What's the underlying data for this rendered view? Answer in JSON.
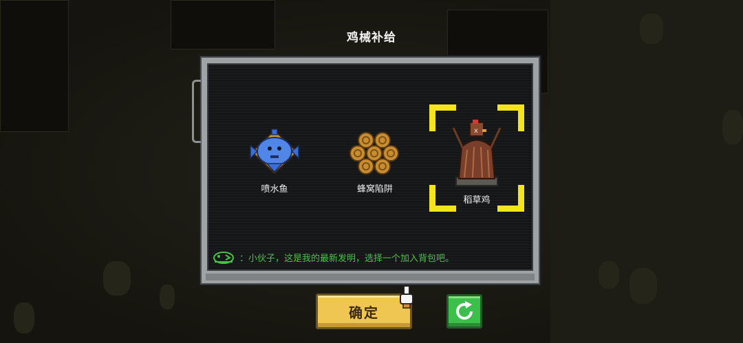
{
  "dialog": {
    "title": "鸡械补给",
    "dialogue_text": "：小伙子，这是我的最新发明，选择一个加入背包吧。"
  },
  "items": [
    {
      "name": "喷水鱼",
      "icon": "spray-fish-icon"
    },
    {
      "name": "蜂窝陷阱",
      "icon": "honeycomb-trap-icon"
    },
    {
      "name": "稻草鸡",
      "icon": "straw-chicken-icon",
      "selected": true
    }
  ],
  "buttons": {
    "confirm_label": "确定",
    "refresh_icon": "refresh-icon"
  },
  "colors": {
    "selector": "#f4e41a",
    "dialogue_text": "#49c24a",
    "confirm_button": "#f0c653",
    "refresh_button": "#3dc04b"
  }
}
